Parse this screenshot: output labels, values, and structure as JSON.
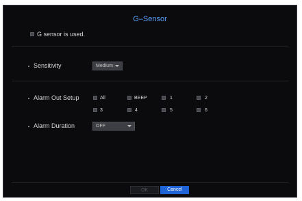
{
  "window": {
    "title": "G–Sensor"
  },
  "gsensor": {
    "label": "G sensor is used.",
    "checked": false
  },
  "sensitivity": {
    "label": "Sensitivity",
    "value": "Medium"
  },
  "alarm_out": {
    "label": "Alarm Out Setup",
    "options": [
      {
        "label": "All",
        "checked": false
      },
      {
        "label": "BEEP",
        "checked": false
      },
      {
        "label": "1",
        "checked": false
      },
      {
        "label": "2",
        "checked": false
      },
      {
        "label": "3",
        "checked": false
      },
      {
        "label": "4",
        "checked": false
      },
      {
        "label": "5",
        "checked": false
      },
      {
        "label": "6",
        "checked": false
      }
    ]
  },
  "alarm_duration": {
    "label": "Alarm Duration",
    "value": "OFF"
  },
  "buttons": {
    "ok": "OK",
    "cancel": "Cancel"
  },
  "colors": {
    "accent": "#5aa0ff",
    "primary_button": "#1f64d6",
    "background": "#0b0b0d"
  }
}
